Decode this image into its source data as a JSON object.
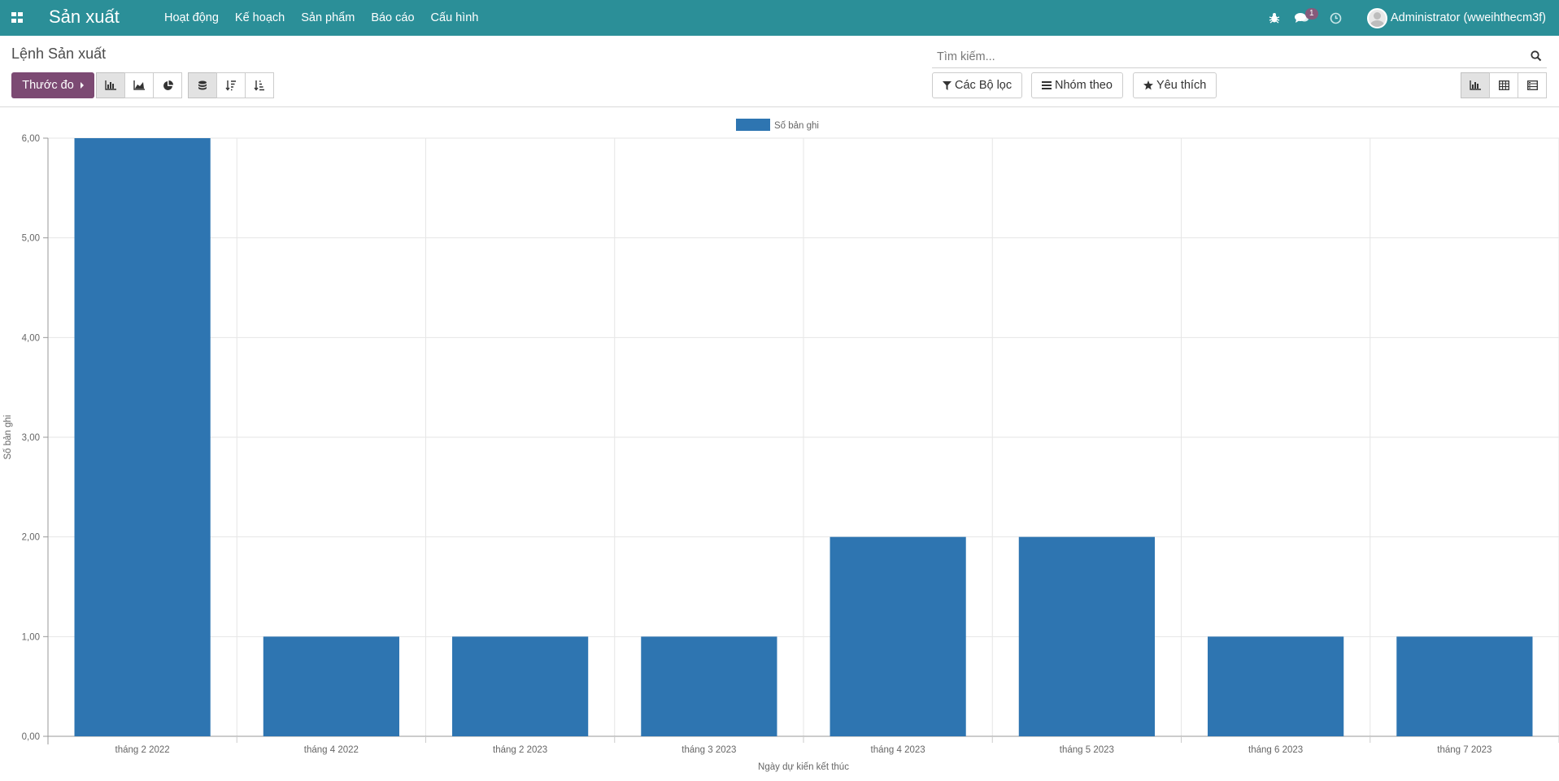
{
  "navbar": {
    "brand": "Sản xuất",
    "menu": [
      "Hoạt động",
      "Kế hoạch",
      "Sản phẩm",
      "Báo cáo",
      "Cấu hình"
    ],
    "messages_badge": "1",
    "user_name": "Administrator (wweihthecm3f)",
    "icons": [
      "apps-icon",
      "bug-icon",
      "chat-icon",
      "clock-icon"
    ]
  },
  "control_panel": {
    "breadcrumb": "Lệnh Sản xuất",
    "search_placeholder": "Tìm kiếm...",
    "measure_label": "Thước đo",
    "filters_label": "Các Bộ lọc",
    "groupby_label": "Nhóm theo",
    "favorites_label": "Yêu thích"
  },
  "colors": {
    "navbar": "#2b8f98",
    "primary": "#7c4a73",
    "bar": "#2e75b1"
  },
  "chart_data": {
    "type": "bar",
    "categories": [
      "tháng 2 2022",
      "tháng 4 2022",
      "tháng 2 2023",
      "tháng 3 2023",
      "tháng 4 2023",
      "tháng 5 2023",
      "tháng 6 2023",
      "tháng 7 2023"
    ],
    "series": [
      {
        "name": "Số bản ghi",
        "values": [
          6,
          1,
          1,
          1,
          2,
          2,
          1,
          1
        ]
      }
    ],
    "xlabel": "Ngày dự kiến kết thúc",
    "ylabel": "Số bản ghi",
    "ylim": [
      0,
      6
    ],
    "yticks": [
      "0,00",
      "1,00",
      "2,00",
      "3,00",
      "4,00",
      "5,00",
      "6,00"
    ],
    "grid": true,
    "legend_position": "top-center"
  }
}
